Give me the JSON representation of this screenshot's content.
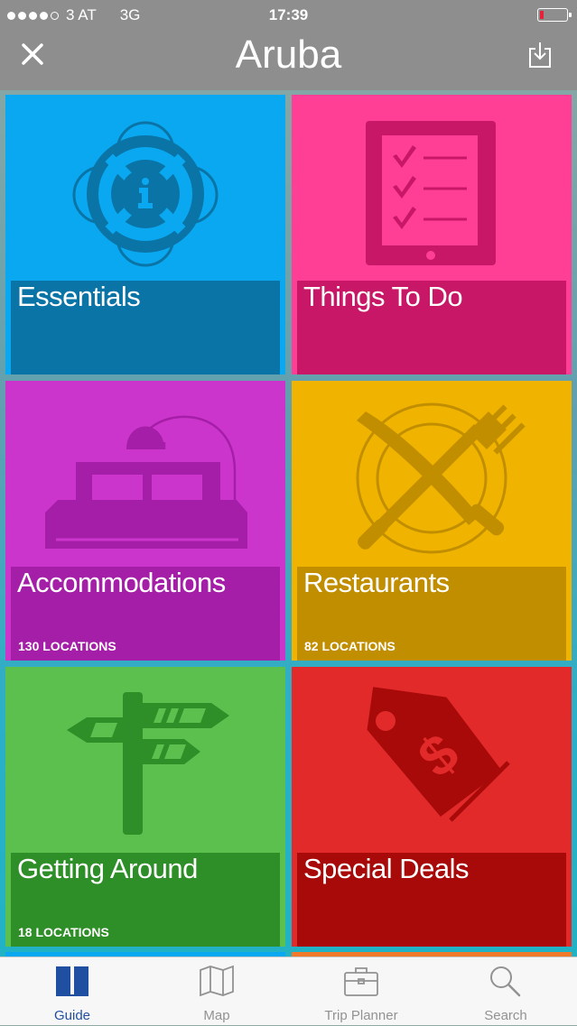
{
  "status_bar": {
    "carrier": "3 AT",
    "network": "3G",
    "time": "17:39"
  },
  "nav": {
    "title": "Aruba",
    "close_icon": "close-icon",
    "download_icon": "download-icon"
  },
  "tiles": [
    {
      "name": "Essentials",
      "count": "",
      "color": "#0aa8f0",
      "band_color": "#0a74a6",
      "icon": "lifebuoy-info-icon"
    },
    {
      "name": "Things To Do",
      "count": "",
      "color": "#ff3f95",
      "band_color": "#c81766",
      "icon": "checklist-tablet-icon"
    },
    {
      "name": "Accommodations",
      "count": "130 LOCATIONS",
      "color": "#cc35cc",
      "band_color": "#a51ea8",
      "icon": "bed-lamp-icon"
    },
    {
      "name": "Restaurants",
      "count": "82 LOCATIONS",
      "color": "#f0b400",
      "band_color": "#c18e00",
      "icon": "knife-fork-plate-icon"
    },
    {
      "name": "Getting Around",
      "count": "18 LOCATIONS",
      "color": "#5cc04f",
      "band_color": "#2e8e27",
      "icon": "signpost-icon"
    },
    {
      "name": "Special Deals",
      "count": "",
      "color": "#e22a2a",
      "band_color": "#a80a0a",
      "icon": "price-tag-dollar-icon"
    }
  ],
  "tabbar": {
    "tabs": [
      {
        "label": "Guide",
        "icon": "book-icon",
        "active": true
      },
      {
        "label": "Map",
        "icon": "map-icon",
        "active": false
      },
      {
        "label": "Trip Planner",
        "icon": "briefcase-icon",
        "active": false
      },
      {
        "label": "Search",
        "icon": "magnifier-icon",
        "active": false
      }
    ],
    "active_color": "#1f4fa0",
    "inactive_color": "#929292"
  }
}
